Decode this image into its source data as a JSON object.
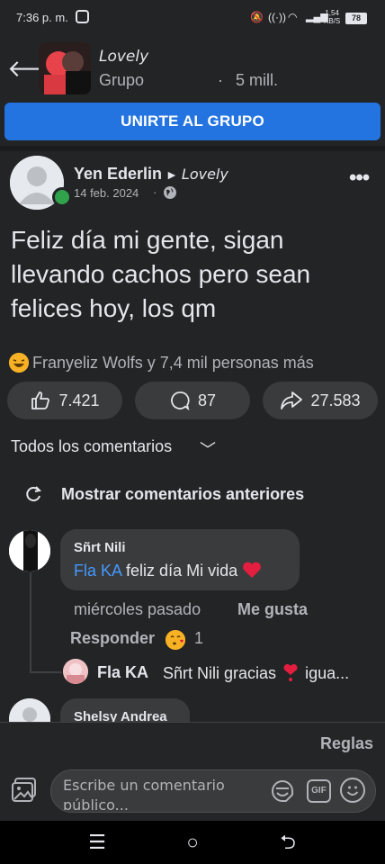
{
  "status_bar": {
    "time": "7:36 p. m.",
    "network_speed": "1,54",
    "network_unit": "KB/S",
    "battery": "78"
  },
  "header": {
    "group_name": "Lovely",
    "group_type": "Grupo",
    "separator": "·",
    "members": "5 mill."
  },
  "join_button": {
    "label": "UNIRTE AL GRUPO"
  },
  "post": {
    "author": "Yen Ederlin",
    "target_group": "Lovely",
    "date": "14 feb. 2024",
    "date_separator": "·",
    "text": "Feliz día mi gente, sigan llevando cachos pero sean felices hoy, los qm",
    "reactions_summary": "Franyeliz Wolfs y 7,4 mil personas más",
    "likes": "7.421",
    "comments": "87",
    "shares": "27.583"
  },
  "comments_section": {
    "filter_label": "Todos los comentarios",
    "show_previous": "Mostrar comentarios anteriores",
    "comments": [
      {
        "author": "Sñrt Nili",
        "mention": "Fla  KA",
        "text": "feliz día Mi vida",
        "time": "miércoles pasado",
        "like_label": "Me gusta",
        "reply_label": "Responder",
        "reaction_count": "1",
        "reply": {
          "author": "Fla  KA",
          "text": "Sñrt Nili gracias",
          "text_tail": "igua..."
        }
      },
      {
        "author": "Shelsy Andrea"
      }
    ]
  },
  "composer": {
    "rules_label": "Reglas",
    "placeholder": "Escribe un comentario público...",
    "gif_label": "GIF"
  },
  "colors": {
    "background": "#232426",
    "primary_button": "#2374e1",
    "mention": "#4599ff",
    "online": "#31a24c",
    "heart": "#e41e3f"
  }
}
